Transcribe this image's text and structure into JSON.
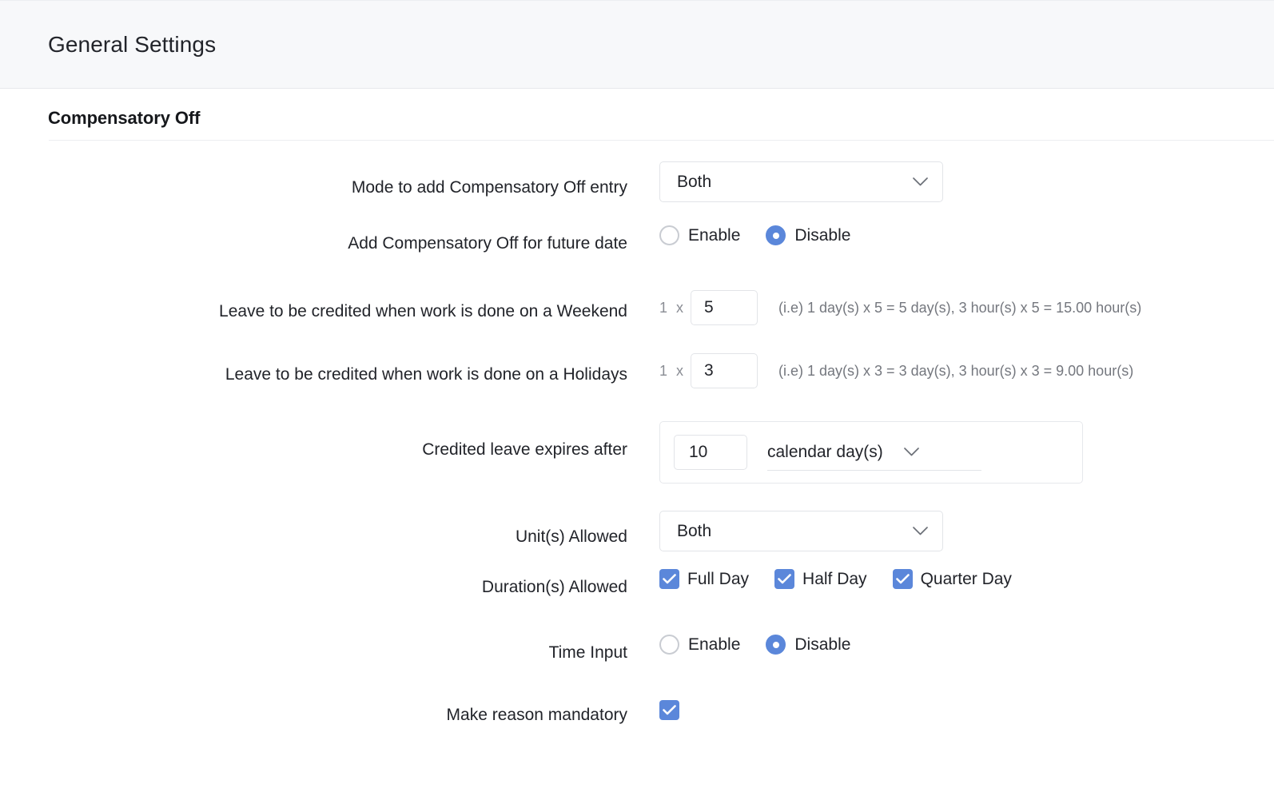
{
  "header": {
    "title": "General Settings"
  },
  "section": {
    "title": "Compensatory Off"
  },
  "fields": {
    "mode": {
      "label": "Mode to add Compensatory Off entry",
      "value": "Both",
      "icon": "chevron-down-icon"
    },
    "future_date": {
      "label": "Add Compensatory Off for future date",
      "options": [
        "Enable",
        "Disable"
      ],
      "selected": "Disable"
    },
    "weekend": {
      "label": "Leave to be credited when work is done on a Weekend",
      "prefix": "1 x",
      "value": "5",
      "hint": "(i.e) 1 day(s) x 5 = 5 day(s), 3 hour(s) x 5 = 15.00 hour(s)"
    },
    "holiday": {
      "label": "Leave to be credited when work is done on a Holidays",
      "prefix": "1 x",
      "value": "3",
      "hint": "(i.e) 1 day(s) x 3 = 3 day(s), 3 hour(s) x 3 = 9.00 hour(s)"
    },
    "expires": {
      "label": "Credited leave expires after",
      "value": "10",
      "unit": "calendar day(s)",
      "icon": "chevron-down-icon"
    },
    "units_allowed": {
      "label": "Unit(s) Allowed",
      "value": "Both",
      "icon": "chevron-down-icon"
    },
    "durations_allowed": {
      "label": "Duration(s) Allowed",
      "options": [
        {
          "label": "Full Day",
          "checked": true
        },
        {
          "label": "Half Day",
          "checked": true
        },
        {
          "label": "Quarter Day",
          "checked": true
        }
      ]
    },
    "time_input": {
      "label": "Time Input",
      "options": [
        "Enable",
        "Disable"
      ],
      "selected": "Disable"
    },
    "reason_mandatory": {
      "label": "Make reason mandatory",
      "checked": true
    }
  },
  "colors": {
    "accent": "#5b87da",
    "header_bg": "#f7f8fa",
    "border": "#e2e4e8",
    "muted_text": "#74777e"
  }
}
